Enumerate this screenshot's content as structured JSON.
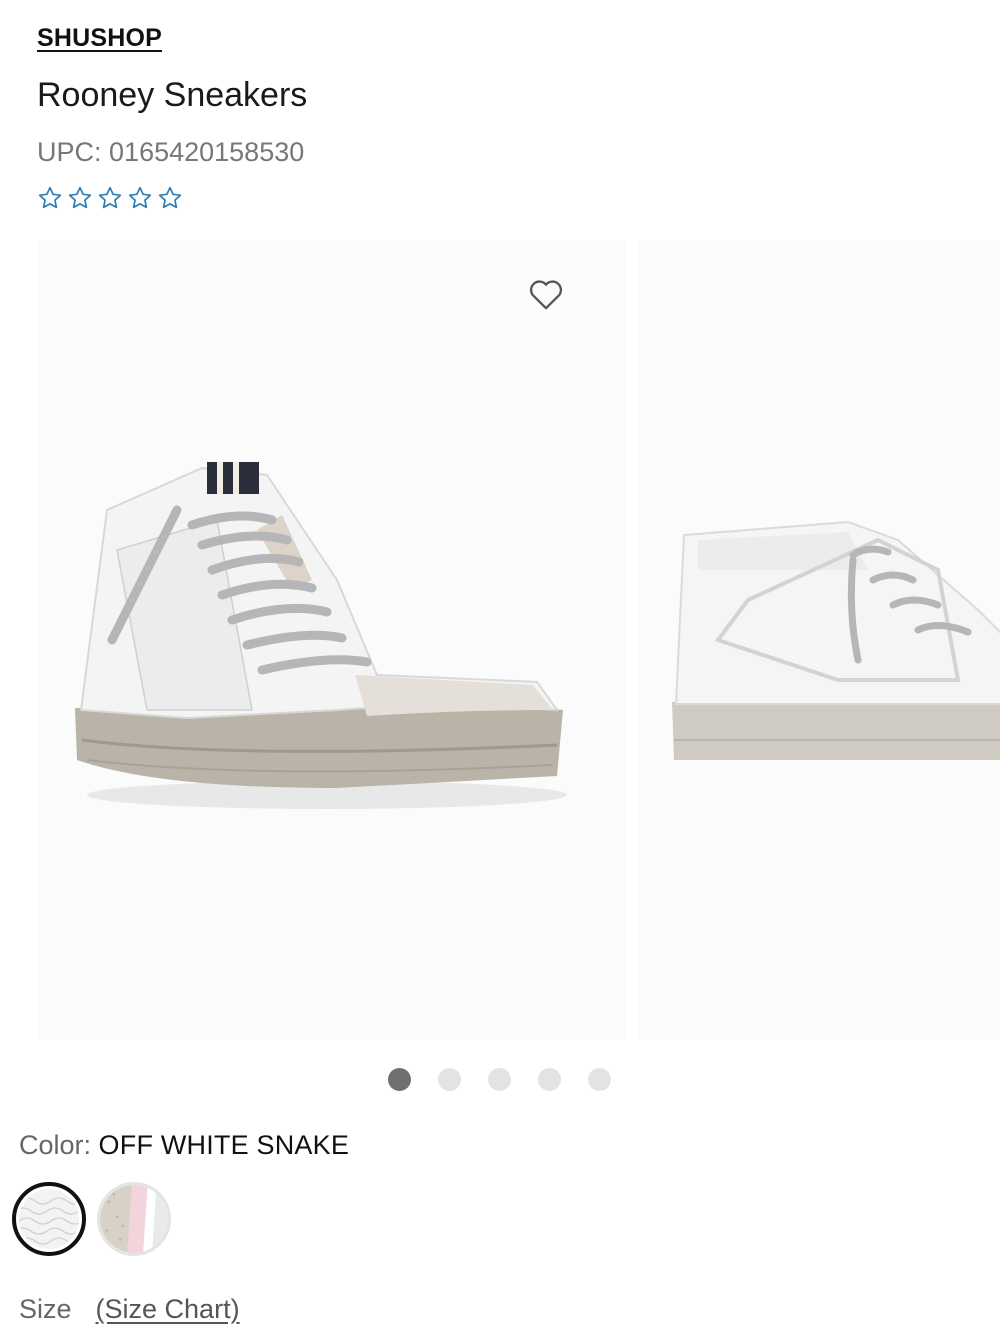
{
  "product": {
    "brand": "SHUSHOP",
    "title": "Rooney Sneakers",
    "upc_label": "UPC:",
    "upc_value": "0165420158530",
    "rating_stars": 5,
    "rating_filled": 0,
    "star_color": "#2f7fb8"
  },
  "gallery": {
    "images": [
      {
        "icon": "sneaker-front-angle-image"
      },
      {
        "icon": "sneaker-side-image"
      }
    ],
    "wishlist_icon": "heart-icon",
    "dots_total": 5,
    "dots_active": 1
  },
  "color": {
    "label": "Color:",
    "value": "OFF WHITE SNAKE",
    "swatches": [
      {
        "name": "off-white-snake",
        "selected": true
      },
      {
        "name": "glitter-pink",
        "selected": false
      }
    ]
  },
  "size": {
    "label": "Size",
    "chart_link": "(Size Chart)"
  }
}
